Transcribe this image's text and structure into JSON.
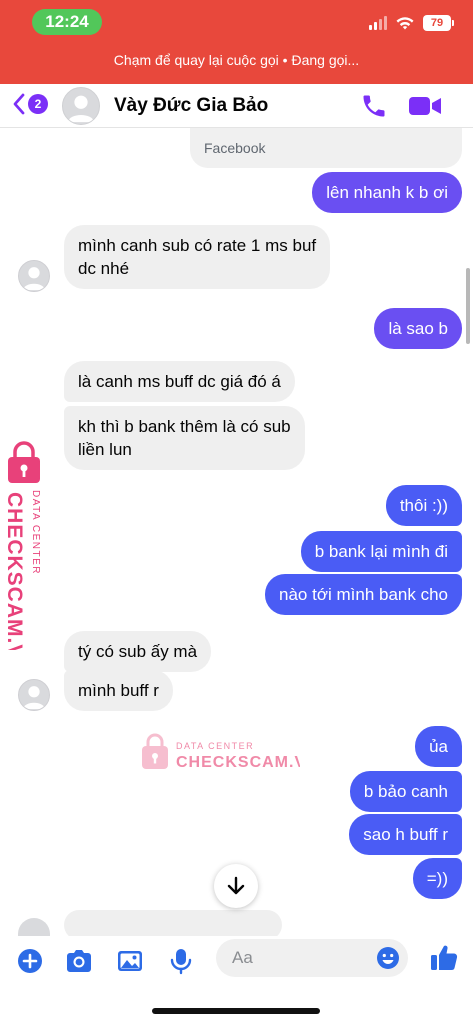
{
  "status_bar": {
    "time": "12:24",
    "battery": "79"
  },
  "call_banner": "Chạm để quay lại cuộc gọi • Đang gọi...",
  "header": {
    "back_badge": "2",
    "contact_name": "Vày Đức Gia Bảo"
  },
  "messages": {
    "facebook_label": "Facebook",
    "m1": "lên nhanh k b ơi",
    "m2_l1": "mình canh sub có rate 1 ms buf",
    "m2_l2": "dc nhé",
    "m3": "là sao b",
    "m4": "là canh ms buff dc giá đó á",
    "m5_l1": "kh thì b bank thêm là có sub",
    "m5_l2": "liền lun",
    "m6": "thôi :))",
    "m7": "b bank lại mình đi",
    "m8": "nào tới mình bank cho",
    "m9": "tý có sub ấy mà",
    "m10": "mình buff r",
    "m11": "ủa",
    "m12": "b bảo canh",
    "m13": "sao h buff r",
    "m14": "=))"
  },
  "watermark": {
    "brand": "CHECKSCAM.VN",
    "tagline": "DATA CENTER"
  },
  "composer": {
    "placeholder": "Aa"
  },
  "colors": {
    "accent": "#7b2ff7",
    "outgoing": "#6a4ff2",
    "incoming": "#efefef",
    "statusbar": "#e8483c",
    "watermark": "#e8417a"
  }
}
